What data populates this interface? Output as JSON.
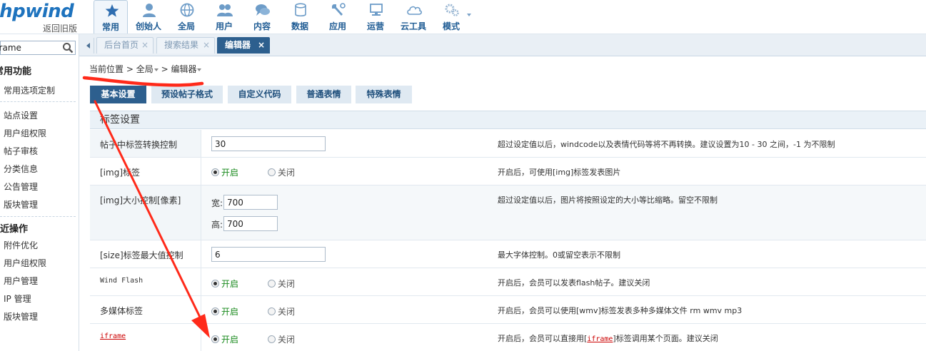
{
  "logo": {
    "text": "phpwind",
    "back_link": "返回旧版"
  },
  "nav": [
    {
      "label": "常用",
      "icon": "star-icon"
    },
    {
      "label": "创始人",
      "icon": "person-icon"
    },
    {
      "label": "全局",
      "icon": "globe-icon"
    },
    {
      "label": "用户",
      "icon": "users-icon"
    },
    {
      "label": "内容",
      "icon": "chat-icon"
    },
    {
      "label": "数据",
      "icon": "database-icon"
    },
    {
      "label": "应用",
      "icon": "wrench-icon"
    },
    {
      "label": "运营",
      "icon": "monitor-icon"
    },
    {
      "label": "云工具",
      "icon": "cloud-icon"
    },
    {
      "label": "模式",
      "icon": "gears-icon"
    }
  ],
  "sidebar": {
    "search_value": "iframe",
    "section1_title": "常用功能",
    "section1_items": [
      "常用选项定制"
    ],
    "section2_items": [
      "站点设置",
      "用户组权限",
      "帖子审核",
      "分类信息",
      "公告管理",
      "版块管理"
    ],
    "section3_title": "最近操作",
    "section3_items": [
      "附件优化",
      "用户组权限",
      "用户管理",
      "IP 管理",
      "版块管理"
    ]
  },
  "tabs": [
    {
      "label": "后台首页",
      "active": false
    },
    {
      "label": "搜索结果",
      "active": false
    },
    {
      "label": "编辑器",
      "active": true
    }
  ],
  "breadcrumb": {
    "prefix": "当前位置",
    "level1": "全局",
    "level2": "编辑器"
  },
  "subtabs": [
    "基本设置",
    "预设帖子格式",
    "自定义代码",
    "普通表情",
    "特殊表情"
  ],
  "section_title": "标签设置",
  "rows": {
    "tag_convert": {
      "label": "帖子中标签转换控制",
      "value": "30",
      "desc": "超过设定值以后，windcode以及表情代码等将不再转换。建议设置为10 - 30 之间，-1 为不限制"
    },
    "img_tag": {
      "label": "[img]标签",
      "on": "开启",
      "off": "关闭",
      "desc": "开启后，可使用[img]标签发表图片"
    },
    "img_size": {
      "label": "[img]大小控制[像素]",
      "width_label": "宽:",
      "width": "700",
      "height_label": "高:",
      "height": "700",
      "desc": "超过设定值以后，图片将按照设定的大小等比缩略。留空不限制"
    },
    "size_tag": {
      "label": "[size]标签最大值控制",
      "value": "6",
      "desc": "最大字体控制。0或留空表示不限制"
    },
    "flash": {
      "label": "Wind Flash",
      "on": "开启",
      "off": "关闭",
      "desc": "开启后，会员可以发表flash帖子。建议关闭"
    },
    "media": {
      "label": "多媒体标签",
      "on": "开启",
      "off": "关闭",
      "desc": "开启后，会员可以使用[wmv]标签发表多种多媒体文件 rm wmv mp3"
    },
    "iframe": {
      "label": "iframe",
      "on": "开启",
      "off": "关闭",
      "desc_pre": "开启后，会员可以直接用[",
      "desc_link": "iframe",
      "desc_post": "]标签调用某个页面。建议关闭"
    }
  },
  "colors": {
    "accent": "#2d5f8e",
    "nav_text": "#1f5c94",
    "on_text": "#198a1d",
    "annotation": "#ff2a1a"
  }
}
